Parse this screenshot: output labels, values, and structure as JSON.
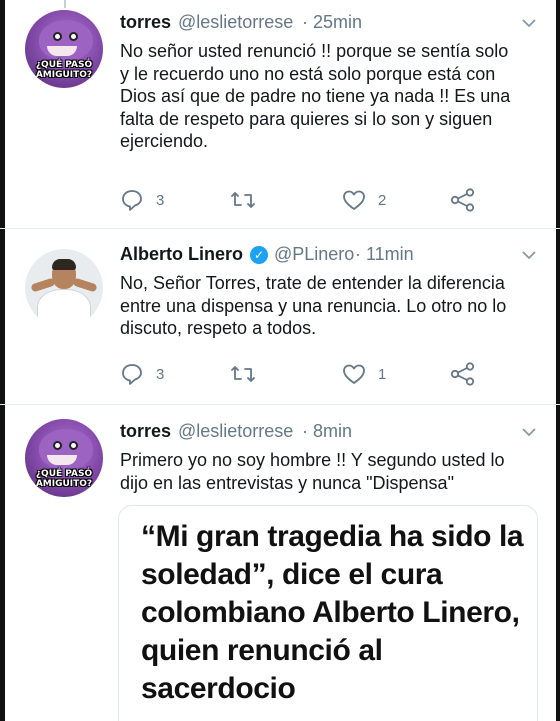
{
  "tweets": [
    {
      "name": "torres",
      "handle": "@leslietorrese",
      "time": "· 25min",
      "avatar_caption": "¿QUÉ PASÓ AMIGUITO?",
      "lines": [
        "No señor usted renunció !! porque se sentía solo",
        "y le recuerdo uno no está solo porque está con",
        "Dios así que de padre no tiene ya nada !! Es una",
        "falta de respeto para quieres si lo son y siguen",
        "ejerciendo."
      ],
      "replies": "3",
      "retweets": "",
      "likes": "2"
    },
    {
      "name": "Alberto Linero",
      "handle": "@PLinero",
      "time": "· 11min",
      "verified": true,
      "lines": [
        "No, Señor Torres, trate de entender la diferencia",
        "entre una dispensa y una renuncia. Lo otro no lo",
        "discuto, respeto a todos."
      ],
      "replies": "3",
      "retweets": "",
      "likes": "1"
    },
    {
      "name": "torres",
      "handle": "@leslietorrese",
      "time": "· 8min",
      "avatar_caption": "¿QUÉ PASÓ AMIGUITO?",
      "lines": [
        "Primero yo no soy hombre !! Y segundo usted lo",
        "dijo en las entrevistas y nunca \"Dispensa\""
      ]
    }
  ],
  "card": {
    "title": "“Mi gran tragedia ha sido la soledad”, dice el cura colombiano Alberto Linero, quien renunció al sacerdocio"
  },
  "icons": {
    "reply": "reply-icon",
    "retweet": "retweet-icon",
    "like": "heart-icon",
    "share": "share-icon",
    "more": "chevron-down-icon",
    "verified": "verified-badge-icon"
  },
  "colors": {
    "secondary_text": "#657786",
    "verified_blue": "#1da1f2",
    "divider": "#e6ecf0"
  }
}
